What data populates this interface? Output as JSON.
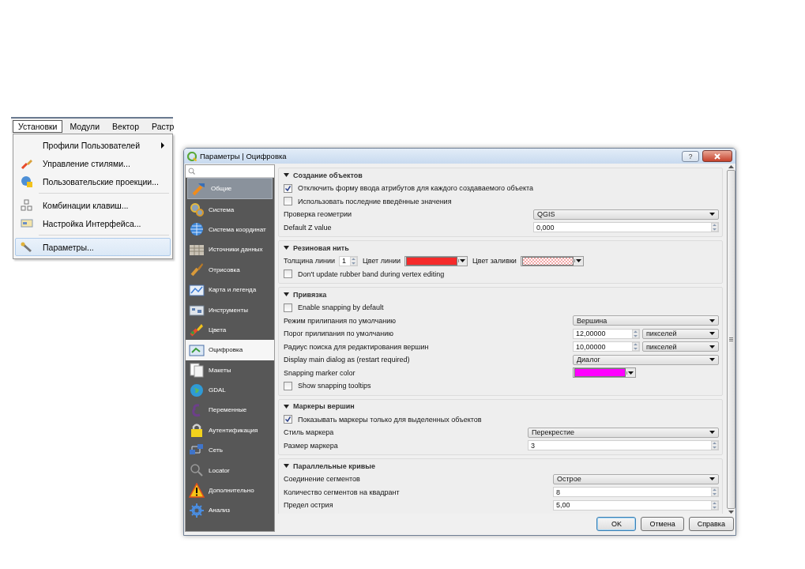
{
  "menubar": [
    {
      "label": "Установки",
      "selected": true
    },
    {
      "label": "Модули",
      "selected": false
    },
    {
      "label": "Вектор",
      "selected": false
    },
    {
      "label": "Растр",
      "selected": false
    }
  ],
  "menu": [
    {
      "kind": "item",
      "label": "Профили Пользователей",
      "submenu": true,
      "hovered": false
    },
    {
      "kind": "item",
      "label": "Управление стилями...",
      "submenu": false,
      "hovered": false
    },
    {
      "kind": "item",
      "label": "Пользовательские проекции...",
      "submenu": false,
      "hovered": false
    },
    {
      "kind": "separator"
    },
    {
      "kind": "item",
      "label": "Комбинации клавиш...",
      "submenu": false,
      "hovered": false
    },
    {
      "kind": "item",
      "label": "Настройка Интерфейса...",
      "submenu": false,
      "hovered": false
    },
    {
      "kind": "separator"
    },
    {
      "kind": "item",
      "label": "Параметры...",
      "submenu": false,
      "hovered": true
    }
  ],
  "dialog": {
    "title": "Параметры | Оцифровка",
    "help": "?",
    "sidebar": [
      {
        "label": "Общие",
        "selected": false,
        "hovered": true
      },
      {
        "label": "Система",
        "selected": false,
        "hovered": false
      },
      {
        "label": "Система координат",
        "selected": false,
        "hovered": false
      },
      {
        "label": "Источники данных",
        "selected": false,
        "hovered": false
      },
      {
        "label": "Отрисовка",
        "selected": false,
        "hovered": false
      },
      {
        "label": "Карта и легенда",
        "selected": false,
        "hovered": false
      },
      {
        "label": "Инструменты",
        "selected": false,
        "hovered": false
      },
      {
        "label": "Цвета",
        "selected": false,
        "hovered": false
      },
      {
        "label": "Оцифровка",
        "selected": true,
        "hovered": false
      },
      {
        "label": "Макеты",
        "selected": false,
        "hovered": false
      },
      {
        "label": "GDAL",
        "selected": false,
        "hovered": false
      },
      {
        "label": "Переменные",
        "selected": false,
        "hovered": false
      },
      {
        "label": "Аутентификация",
        "selected": false,
        "hovered": false
      },
      {
        "label": "Сеть",
        "selected": false,
        "hovered": false
      },
      {
        "label": "Locator",
        "selected": false,
        "hovered": false
      },
      {
        "label": "Дополнительно",
        "selected": false,
        "hovered": false
      },
      {
        "label": "Анализ",
        "selected": false,
        "hovered": false
      }
    ],
    "groups": [
      {
        "title": "Создание объектов",
        "expanded": true,
        "rows": [
          {
            "kind": "checkbox",
            "label": "Отключить форму ввода атрибутов для каждого создаваемого объекта",
            "checked": true
          },
          {
            "kind": "checkbox",
            "label": "Использовать последние введённые значения",
            "checked": false
          },
          {
            "kind": "combo",
            "label": "Проверка геометрии",
            "value": "QGIS"
          },
          {
            "kind": "spin",
            "label": "Default Z value",
            "value": "0,000"
          }
        ]
      },
      {
        "title": "Резиновая нить",
        "expanded": true,
        "rows": [
          {
            "kind": "inline",
            "items": [
              {
                "kind": "label",
                "text": "Толщина линии"
              },
              {
                "kind": "spin",
                "value": "1"
              },
              {
                "kind": "label",
                "text": "Цвет линии"
              },
              {
                "kind": "color",
                "color": "#f52a2a"
              },
              {
                "kind": "label",
                "text": "Цвет заливки"
              },
              {
                "kind": "pattern",
                "color": "#f2a6a6"
              }
            ]
          },
          {
            "kind": "checkbox",
            "label": "Don't update rubber band during vertex editing",
            "checked": false
          }
        ]
      },
      {
        "title": "Привязка",
        "expanded": true,
        "rows": [
          {
            "kind": "checkbox",
            "label": "Enable snapping by default",
            "checked": false
          },
          {
            "kind": "combo",
            "label": "Режим прилипания по умолчанию",
            "value": "Вершина"
          },
          {
            "kind": "spin_unit",
            "label": "Порог прилипания по умолчанию",
            "value": "12,00000",
            "unit": "пикселей"
          },
          {
            "kind": "spin_unit",
            "label": "Радиус поиска для редактирования вершин",
            "value": "10,00000",
            "unit": "пикселей"
          },
          {
            "kind": "combo",
            "label": "Display main dialog as (restart required)",
            "value": "Диалог"
          },
          {
            "kind": "color",
            "label": "Snapping marker color",
            "color": "#ff00ff"
          },
          {
            "kind": "checkbox",
            "label": "Show snapping tooltips",
            "checked": false
          }
        ]
      },
      {
        "title": "Маркеры вершин",
        "expanded": true,
        "rows": [
          {
            "kind": "checkbox",
            "label": "Показывать маркеры только для выделенных объектов",
            "checked": true
          },
          {
            "kind": "combo",
            "label": "Стиль маркера",
            "value": "Перекрестие"
          },
          {
            "kind": "spin",
            "label": "Размер маркера",
            "value": "3"
          }
        ]
      },
      {
        "title": "Параллельные кривые",
        "expanded": true,
        "rows": [
          {
            "kind": "combo",
            "label": "Соединение сегментов",
            "value": "Острое"
          },
          {
            "kind": "spin",
            "label": "Количество сегментов на квадрант",
            "value": "8"
          },
          {
            "kind": "spin",
            "label": "Предел острия",
            "value": "5,00"
          }
        ]
      }
    ],
    "buttons": [
      {
        "label": "OK",
        "default": true
      },
      {
        "label": "Отмена",
        "default": false
      },
      {
        "label": "Справка",
        "default": false
      }
    ]
  }
}
